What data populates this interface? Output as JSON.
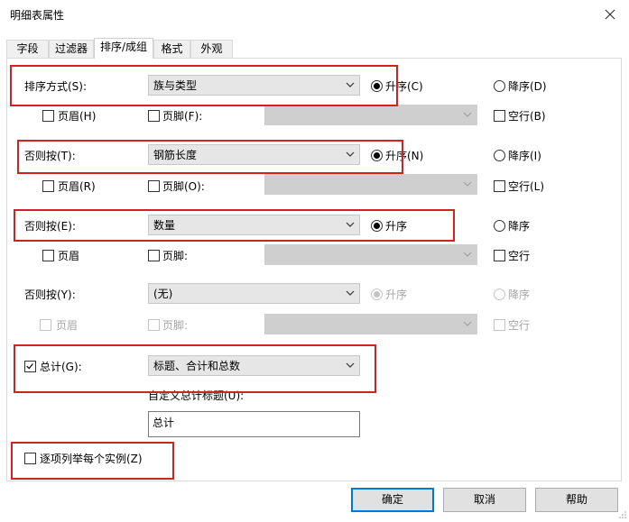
{
  "window": {
    "title": "明细表属性"
  },
  "tabs": [
    "字段",
    "过滤器",
    "排序/成组",
    "格式",
    "外观"
  ],
  "sort_rows": [
    {
      "label": "排序方式(S):",
      "field": "族与类型",
      "asc": "升序(C)",
      "desc": "降序(D)",
      "header": "页眉(H)",
      "footer": "页脚(F):",
      "blank": "空行(B)"
    },
    {
      "label": "否则按(T):",
      "field": "钢筋长度",
      "asc": "升序(N)",
      "desc": "降序(I)",
      "header": "页眉(R)",
      "footer": "页脚(O):",
      "blank": "空行(L)"
    },
    {
      "label": "否则按(E):",
      "field": "数量",
      "asc": "升序",
      "desc": "降序",
      "header": "页眉",
      "footer": "页脚:",
      "blank": "空行"
    },
    {
      "label": "否则按(Y):",
      "field": "(无)",
      "asc": "升序",
      "desc": "降序",
      "header": "页眉",
      "footer": "页脚:",
      "blank": "空行"
    }
  ],
  "totals": {
    "label": "总计(G):",
    "value": "标题、合计和总数",
    "custom_title_label": "自定义总计标题(U):",
    "custom_title_value": "总计"
  },
  "itemize": {
    "label": "逐项列举每个实例(Z)"
  },
  "buttons": {
    "ok": "确定",
    "cancel": "取消",
    "help": "帮助"
  },
  "colors": {
    "annotation": "#d42020",
    "accent": "#0078d7"
  }
}
